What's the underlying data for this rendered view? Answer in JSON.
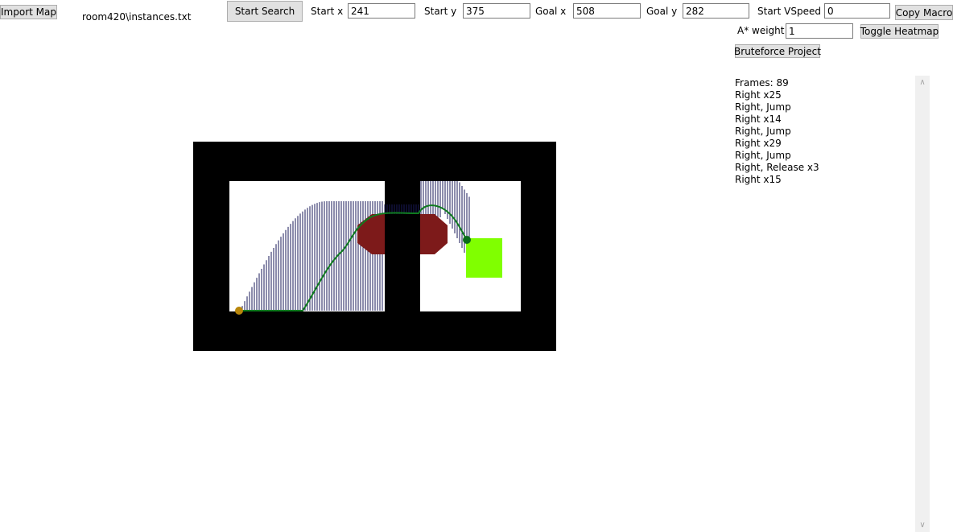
{
  "toolbar": {
    "import_map_label": "Import Map",
    "file_path": "room420\\instances.txt",
    "start_search_label": "Start Search",
    "start_x_label": "Start x",
    "start_x_value": "241",
    "start_y_label": "Start y",
    "start_y_value": "375",
    "goal_x_label": "Goal x",
    "goal_x_value": "508",
    "goal_y_label": "Goal y",
    "goal_y_value": "282",
    "start_vspeed_label": "Start VSpeed",
    "start_vspeed_value": "0",
    "copy_macro_label": "Copy Macro",
    "astar_weight_label": "A* weight",
    "astar_weight_value": "1",
    "toggle_heatmap_label": "Toggle Heatmap",
    "bruteforce_label": "Bruteforce Project"
  },
  "macro": {
    "lines": [
      "Frames: 89",
      "Right x25",
      "Right, Jump",
      "Right x14",
      "Right, Jump",
      "Right x29",
      "Right, Jump",
      "Right, Release x3",
      "Right x15"
    ]
  },
  "scrollbar": {
    "up_icon": "chevron-up-icon",
    "down_icon": "chevron-down-icon"
  },
  "map": {
    "colors": {
      "wall": "#000000",
      "floor": "#ffffff",
      "spike": "#7d1a1a",
      "goal": "#80ff00",
      "path": "#0f7a1f",
      "start_marker": "#b8860b",
      "end_marker": "#0a6b1a",
      "explored_lines": "#1a1a5a"
    }
  }
}
